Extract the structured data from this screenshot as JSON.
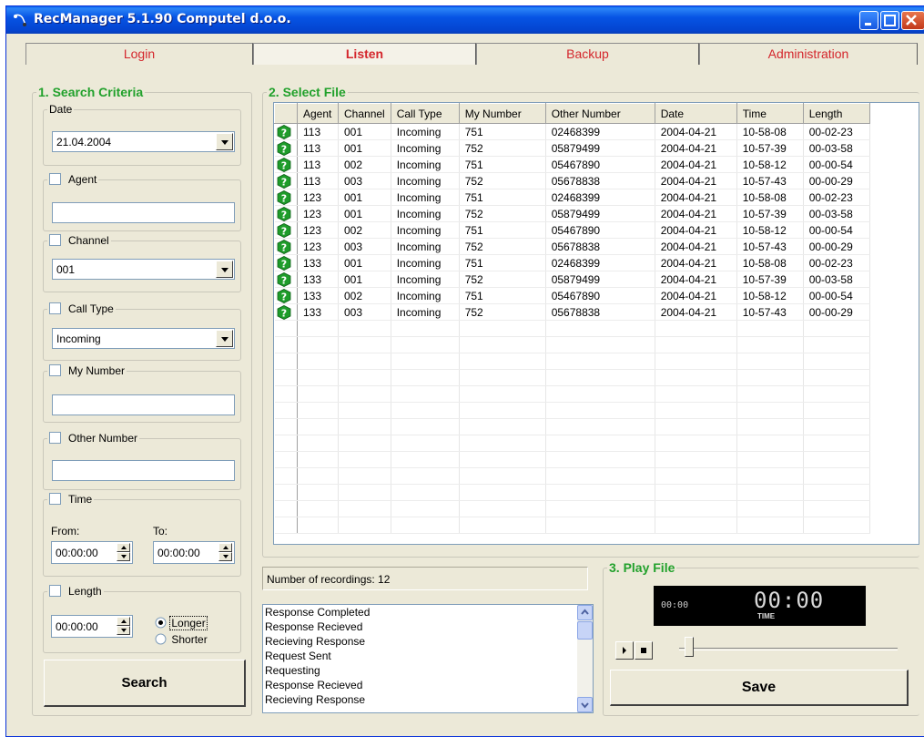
{
  "window": {
    "title": "RecManager 5.1.90 Computel d.o.o."
  },
  "tabs": [
    {
      "label": "Login"
    },
    {
      "label": "Listen"
    },
    {
      "label": "Backup"
    },
    {
      "label": "Administration"
    }
  ],
  "search": {
    "title": "1. Search Criteria",
    "date_label": "Date",
    "date_value": "21.04.2004",
    "agent_label": "Agent",
    "channel_label": "Channel",
    "channel_value": "001",
    "calltype_label": "Call Type",
    "calltype_value": "Incoming",
    "mynumber_label": "My Number",
    "othernumber_label": "Other Number",
    "time_label": "Time",
    "from_label": "From:",
    "to_label": "To:",
    "from_value": "00:00:00",
    "to_value": "00:00:00",
    "length_label": "Length",
    "length_value": "00:00:00",
    "longer_label": "Longer",
    "shorter_label": "Shorter",
    "search_button": "Search"
  },
  "files": {
    "title": "2. Select File",
    "columns": [
      "Agent",
      "Channel",
      "Call Type",
      "My Number",
      "Other Number",
      "Date",
      "Time",
      "Length"
    ],
    "rows": [
      [
        "113",
        "001",
        "Incoming",
        "751",
        "02468399",
        "2004-04-21",
        "10-58-08",
        "00-02-23"
      ],
      [
        "113",
        "001",
        "Incoming",
        "752",
        "05879499",
        "2004-04-21",
        "10-57-39",
        "00-03-58"
      ],
      [
        "113",
        "002",
        "Incoming",
        "751",
        "05467890",
        "2004-04-21",
        "10-58-12",
        "00-00-54"
      ],
      [
        "113",
        "003",
        "Incoming",
        "752",
        "05678838",
        "2004-04-21",
        "10-57-43",
        "00-00-29"
      ],
      [
        "123",
        "001",
        "Incoming",
        "751",
        "02468399",
        "2004-04-21",
        "10-58-08",
        "00-02-23"
      ],
      [
        "123",
        "001",
        "Incoming",
        "752",
        "05879499",
        "2004-04-21",
        "10-57-39",
        "00-03-58"
      ],
      [
        "123",
        "002",
        "Incoming",
        "751",
        "05467890",
        "2004-04-21",
        "10-58-12",
        "00-00-54"
      ],
      [
        "123",
        "003",
        "Incoming",
        "752",
        "05678838",
        "2004-04-21",
        "10-57-43",
        "00-00-29"
      ],
      [
        "133",
        "001",
        "Incoming",
        "751",
        "02468399",
        "2004-04-21",
        "10-58-08",
        "00-02-23"
      ],
      [
        "133",
        "001",
        "Incoming",
        "752",
        "05879499",
        "2004-04-21",
        "10-57-39",
        "00-03-58"
      ],
      [
        "133",
        "002",
        "Incoming",
        "751",
        "05467890",
        "2004-04-21",
        "10-58-12",
        "00-00-54"
      ],
      [
        "133",
        "003",
        "Incoming",
        "752",
        "05678838",
        "2004-04-21",
        "10-57-43",
        "00-00-29"
      ]
    ],
    "status": "Number of recordings: 12"
  },
  "log": [
    "Response Completed",
    "Response Recieved",
    "Recieving Response",
    "Request Sent",
    "Requesting",
    "Response Recieved",
    "Recieving Response"
  ],
  "player": {
    "title": "3. Play File",
    "elapsed": "00:00",
    "time_display": "00:00",
    "time_caption": "TIME",
    "save_button": "Save"
  },
  "colors": {
    "tab_text": "#d4262c",
    "group_title": "#22a12c",
    "row_icon": "#1e9c2a"
  }
}
